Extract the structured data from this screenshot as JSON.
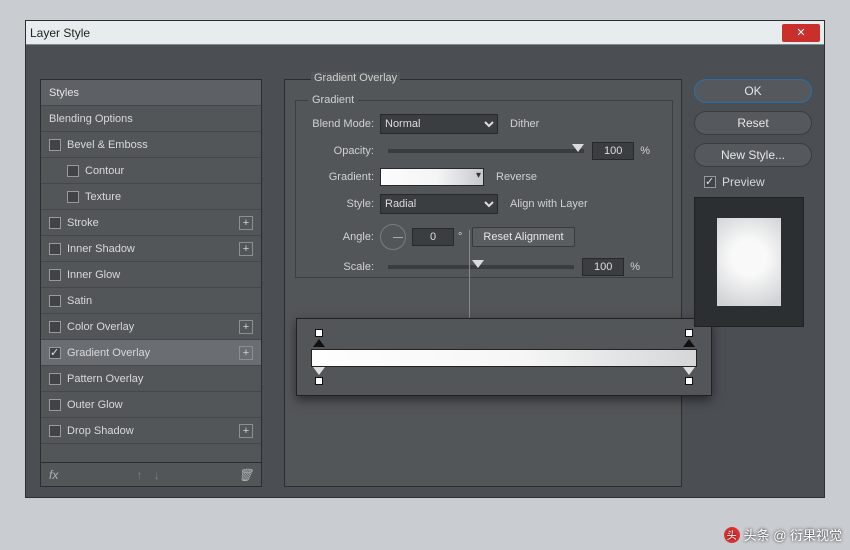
{
  "title": "Layer Style",
  "effects": {
    "header": "Styles",
    "blending": "Blending Options",
    "items": [
      {
        "label": "Bevel & Emboss",
        "checked": false,
        "plus": false,
        "indent": 0
      },
      {
        "label": "Contour",
        "checked": false,
        "plus": false,
        "indent": 1
      },
      {
        "label": "Texture",
        "checked": false,
        "plus": false,
        "indent": 1
      },
      {
        "label": "Stroke",
        "checked": false,
        "plus": true,
        "indent": 0
      },
      {
        "label": "Inner Shadow",
        "checked": false,
        "plus": true,
        "indent": 0
      },
      {
        "label": "Inner Glow",
        "checked": false,
        "plus": false,
        "indent": 0
      },
      {
        "label": "Satin",
        "checked": false,
        "plus": false,
        "indent": 0
      },
      {
        "label": "Color Overlay",
        "checked": false,
        "plus": true,
        "indent": 0
      },
      {
        "label": "Gradient Overlay",
        "checked": true,
        "plus": true,
        "indent": 0,
        "selected": true
      },
      {
        "label": "Pattern Overlay",
        "checked": false,
        "plus": false,
        "indent": 0
      },
      {
        "label": "Outer Glow",
        "checked": false,
        "plus": false,
        "indent": 0
      },
      {
        "label": "Drop Shadow",
        "checked": false,
        "plus": true,
        "indent": 0
      }
    ],
    "footer_fx": "fx"
  },
  "settings": {
    "section": "Gradient Overlay",
    "legend": "Gradient",
    "blend_label": "Blend Mode:",
    "blend_value": "Normal",
    "dither_label": "Dither",
    "dither_checked": true,
    "opacity_label": "Opacity:",
    "opacity_value": "100",
    "pct": "%",
    "gradient_label": "Gradient:",
    "reverse_label": "Reverse",
    "reverse_checked": false,
    "style_label": "Style:",
    "style_value": "Radial",
    "align_label": "Align with Layer",
    "align_checked": true,
    "angle_label": "Angle:",
    "angle_value": "0",
    "deg": "°",
    "reset_align": "Reset Alignment",
    "scale_label": "Scale:",
    "scale_value": "100"
  },
  "right": {
    "ok": "OK",
    "reset": "Reset",
    "new_style": "New Style...",
    "preview": "Preview"
  },
  "watermark": "头条 @ 衍果视觉"
}
